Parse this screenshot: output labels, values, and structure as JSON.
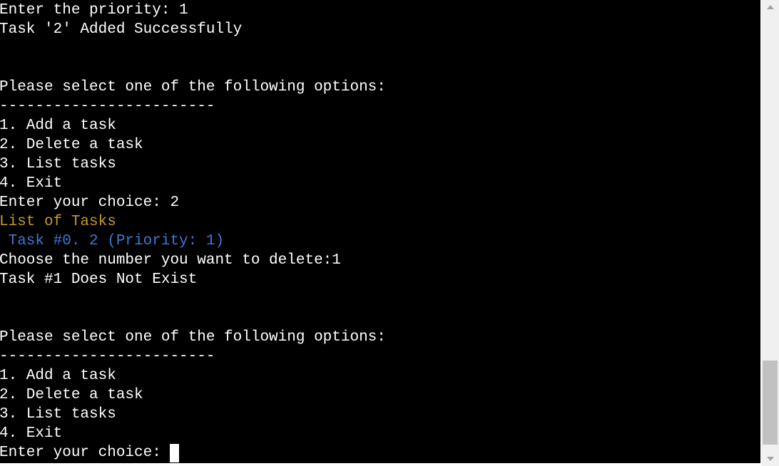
{
  "terminal": {
    "lines": [
      {
        "text": "Enter the priority: 1",
        "color": "#ffffff"
      },
      {
        "text": "Task '2' Added Successfully",
        "color": "#ffffff"
      },
      {
        "text": "",
        "color": "#ffffff"
      },
      {
        "text": "",
        "color": "#ffffff"
      },
      {
        "text": "Please select one of the following options:",
        "color": "#ffffff"
      },
      {
        "text": "------------------------",
        "color": "#ffffff"
      },
      {
        "text": "1. Add a task",
        "color": "#ffffff"
      },
      {
        "text": "2. Delete a task",
        "color": "#ffffff"
      },
      {
        "text": "3. List tasks",
        "color": "#ffffff"
      },
      {
        "text": "4. Exit",
        "color": "#ffffff"
      },
      {
        "text": "Enter your choice: 2",
        "color": "#ffffff"
      },
      {
        "text": "List of Tasks",
        "color": "#c09a2b"
      },
      {
        "text": " Task #0. 2 (Priority: 1)",
        "color": "#3b78d8"
      },
      {
        "text": "Choose the number you want to delete:1",
        "color": "#ffffff"
      },
      {
        "text": "Task #1 Does Not Exist",
        "color": "#ffffff"
      },
      {
        "text": "",
        "color": "#ffffff"
      },
      {
        "text": "",
        "color": "#ffffff"
      },
      {
        "text": "Please select one of the following options:",
        "color": "#ffffff"
      },
      {
        "text": "------------------------",
        "color": "#ffffff"
      },
      {
        "text": "1. Add a task",
        "color": "#ffffff"
      },
      {
        "text": "2. Delete a task",
        "color": "#ffffff"
      },
      {
        "text": "3. List tasks",
        "color": "#ffffff"
      },
      {
        "text": "4. Exit",
        "color": "#ffffff"
      }
    ],
    "prompt": "Enter your choice: ",
    "background": "#000000"
  },
  "scrollbar": {
    "up_icon": "scroll-up-arrow-icon",
    "down_icon": "scroll-down-arrow-icon"
  }
}
